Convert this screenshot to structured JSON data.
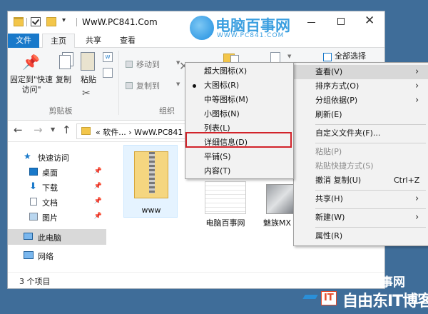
{
  "window": {
    "title": "WwW.PC841.Com",
    "quick_access_more": "▾"
  },
  "ribbon_tabs": [
    "文件",
    "主页",
    "共享",
    "查看"
  ],
  "ribbon": {
    "pin_label": "固定到\"快速访问\"",
    "copy_label": "复制",
    "paste_label": "粘贴",
    "clipboard_group": "剪贴板",
    "move_to": "移动到",
    "copy_to": "复制到",
    "organize_group": "组织",
    "select_all": "全部选择"
  },
  "address": {
    "path": "« 软件... › WwW.PC841 ›"
  },
  "nav_pane": {
    "quick_access": "快速访问",
    "desktop": "桌面",
    "downloads": "下载",
    "documents": "文档",
    "pictures": "图片",
    "this_pc": "此电脑",
    "network": "网络"
  },
  "files": [
    {
      "name": "www"
    },
    {
      "name": "电脑百事网"
    },
    {
      "name": "魅族MX"
    }
  ],
  "status": {
    "item_count": "3 个项目"
  },
  "context_menu": {
    "view": "查看(V)",
    "sort": "排序方式(O)",
    "group": "分组依据(P)",
    "refresh": "刷新(E)",
    "customize": "自定义文件夹(F)...",
    "paste": "粘贴(P)",
    "paste_shortcut": "粘贴快捷方式(S)",
    "undo": "撤消 复制(U)",
    "undo_shortcut": "Ctrl+Z",
    "share": "共享(H)",
    "new": "新建(W)",
    "properties": "属性(R)"
  },
  "view_submenu": {
    "extra_large": "超大图标(X)",
    "large": "大图标(R)",
    "medium": "中等图标(M)",
    "small": "小图标(N)",
    "list": "列表(L)",
    "details": "详细信息(D)",
    "tiles": "平铺(S)",
    "content": "内容(T)",
    "selected": "large"
  },
  "watermarks": {
    "top_brand": "电脑百事网",
    "top_url": "WWW.PC841.COM",
    "bottom_line1": "脑百事网",
    "bottom_it": "IT",
    "bottom_line2": "自由东IT博客"
  },
  "colors": {
    "accent": "#1979ca",
    "highlight_border": "#d2232a",
    "menu_bg": "#f2f2f2"
  }
}
